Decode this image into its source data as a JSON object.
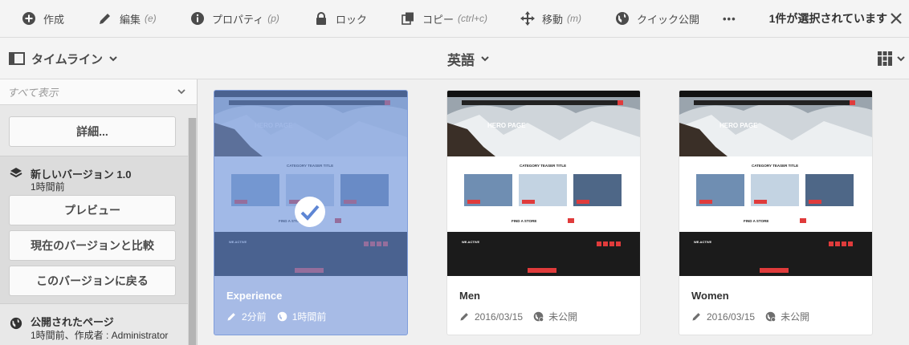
{
  "toolbar": {
    "actions": [
      {
        "label": "作成",
        "shortcut": "",
        "icon": "plus-circle-icon"
      },
      {
        "label": "編集",
        "shortcut": "(e)",
        "icon": "pencil-icon"
      },
      {
        "label": "プロパティ",
        "shortcut": "(p)",
        "icon": "info-icon"
      },
      {
        "label": "ロック",
        "shortcut": "",
        "icon": "lock-icon"
      },
      {
        "label": "コピー",
        "shortcut": "(ctrl+c)",
        "icon": "copy-icon"
      },
      {
        "label": "移動",
        "shortcut": "(m)",
        "icon": "move-icon"
      },
      {
        "label": "クイック公開",
        "shortcut": "",
        "icon": "globe-icon"
      },
      {
        "label": "•••",
        "shortcut": "",
        "icon": "more-icon"
      }
    ],
    "selection_text": "1件が選択されています"
  },
  "secondary": {
    "rail_label": "タイムライン",
    "language": "英語"
  },
  "rail": {
    "filter_label": "すべて表示",
    "details_button": "詳細...",
    "version": {
      "title": "新しいバージョン 1.0",
      "time": "1時間前",
      "preview_button": "プレビュー",
      "compare_button": "現在のバージョンと比較",
      "revert_button": "このバージョンに戻る"
    },
    "published": {
      "title": "公開されたページ",
      "info": "1時間前、作成者 : Administrator"
    }
  },
  "cards": [
    {
      "title": "Experience",
      "modified": "2分前",
      "published": "1時間前",
      "selected": true
    },
    {
      "title": "Men",
      "modified": "2016/03/15",
      "published": "未公開",
      "selected": false
    },
    {
      "title": "Women",
      "modified": "2016/03/15",
      "published": "未公開",
      "selected": false
    }
  ],
  "thumbnail": {
    "hero": "HERO PAGE",
    "teaser": "CATEGORY TEASER TITLE",
    "store": "FIND A STORE",
    "brand": "WE.ACTIVE"
  },
  "colors": {
    "selected_card": "#a7bbe6",
    "accent_red": "#e03b3b",
    "footer_dark": "#1b1b1b"
  }
}
